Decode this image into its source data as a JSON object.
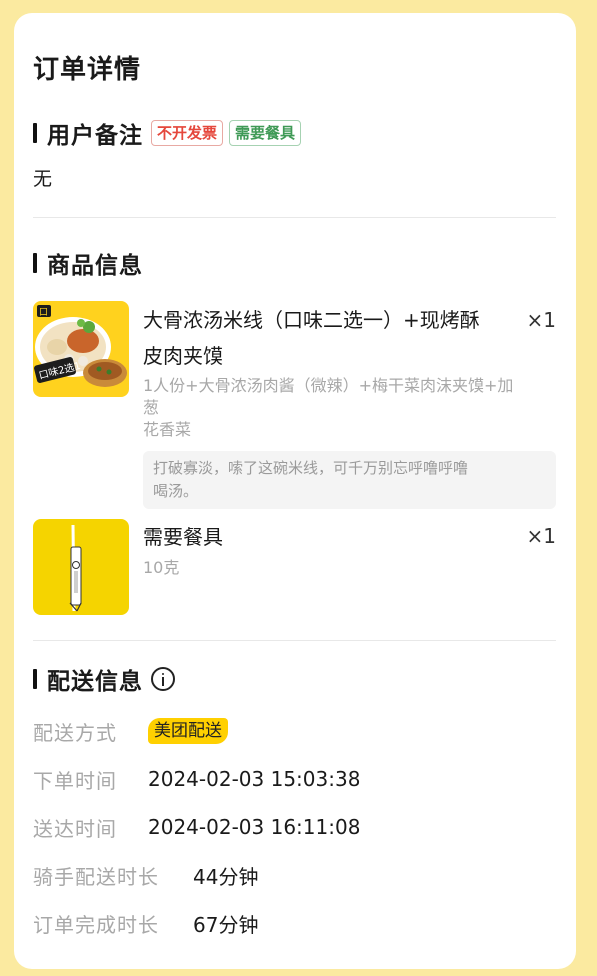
{
  "page": {
    "title": "订单详情"
  },
  "remark": {
    "section_title": "用户备注",
    "tags": [
      "不开发票",
      "需要餐具"
    ],
    "text": "无"
  },
  "products": {
    "section_title": "商品信息",
    "items": [
      {
        "name": "大骨浓汤米线（口味二选一）+现烤酥皮肉夹馍",
        "name_line1": "大骨浓汤米线（口味二选一）+现烤酥",
        "name_line2": "皮肉夹馍",
        "qty": "×1",
        "spec_line1": "1人份+大骨浓汤肉酱（微辣）+梅干菜肉沫夹馍+加葱",
        "spec_line2": "花香菜",
        "note_line1": "打破寡淡，嗦了这碗米线，可千万别忘呼噜呼噜",
        "note_line2": "喝汤。",
        "image_icon": "noodle-bowl-image",
        "image_badge": "口味2选1"
      },
      {
        "name": "需要餐具",
        "qty": "×1",
        "spec": "10克",
        "image_icon": "chopsticks-image"
      }
    ]
  },
  "delivery": {
    "section_title": "配送信息",
    "rows": [
      {
        "label": "配送方式",
        "value": "美团配送"
      },
      {
        "label": "下单时间",
        "value": "2024-02-03 15:03:38"
      },
      {
        "label": "送达时间",
        "value": "2024-02-03 16:11:08"
      },
      {
        "label": "骑手配送时长",
        "value": "44分钟"
      },
      {
        "label": "订单完成时长",
        "value": "67分钟"
      }
    ]
  },
  "colors": {
    "page_background": "#fbeaa0",
    "brand_yellow": "#ffd000",
    "tag_red": "#e5473c",
    "tag_green": "#3f9a56"
  }
}
